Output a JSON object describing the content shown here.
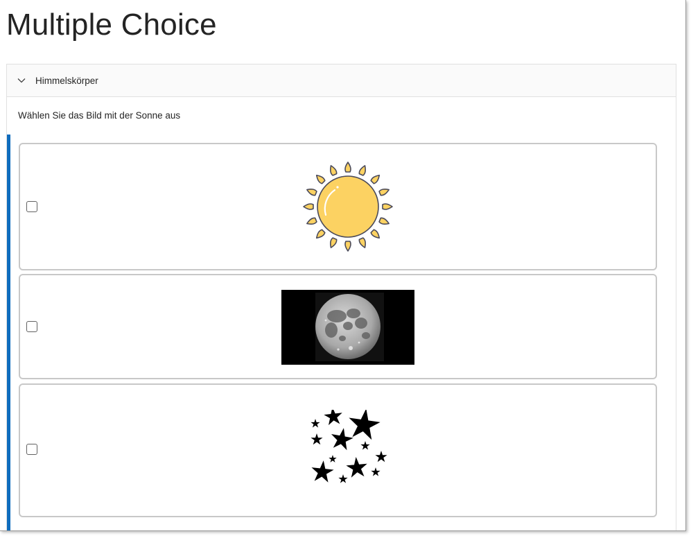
{
  "page": {
    "title": "Multiple Choice"
  },
  "section": {
    "title": "Himmelskörper",
    "expanded": true,
    "chevron_icon": "chevron-down-icon"
  },
  "question": {
    "text": "Wählen Sie das Bild mit der Sonne aus",
    "accent_color": "#0f6cbd",
    "options": [
      {
        "image": "sun-illustration",
        "checked": false
      },
      {
        "image": "full-moon-photo",
        "checked": false
      },
      {
        "image": "stars-cluster",
        "checked": false
      }
    ]
  }
}
